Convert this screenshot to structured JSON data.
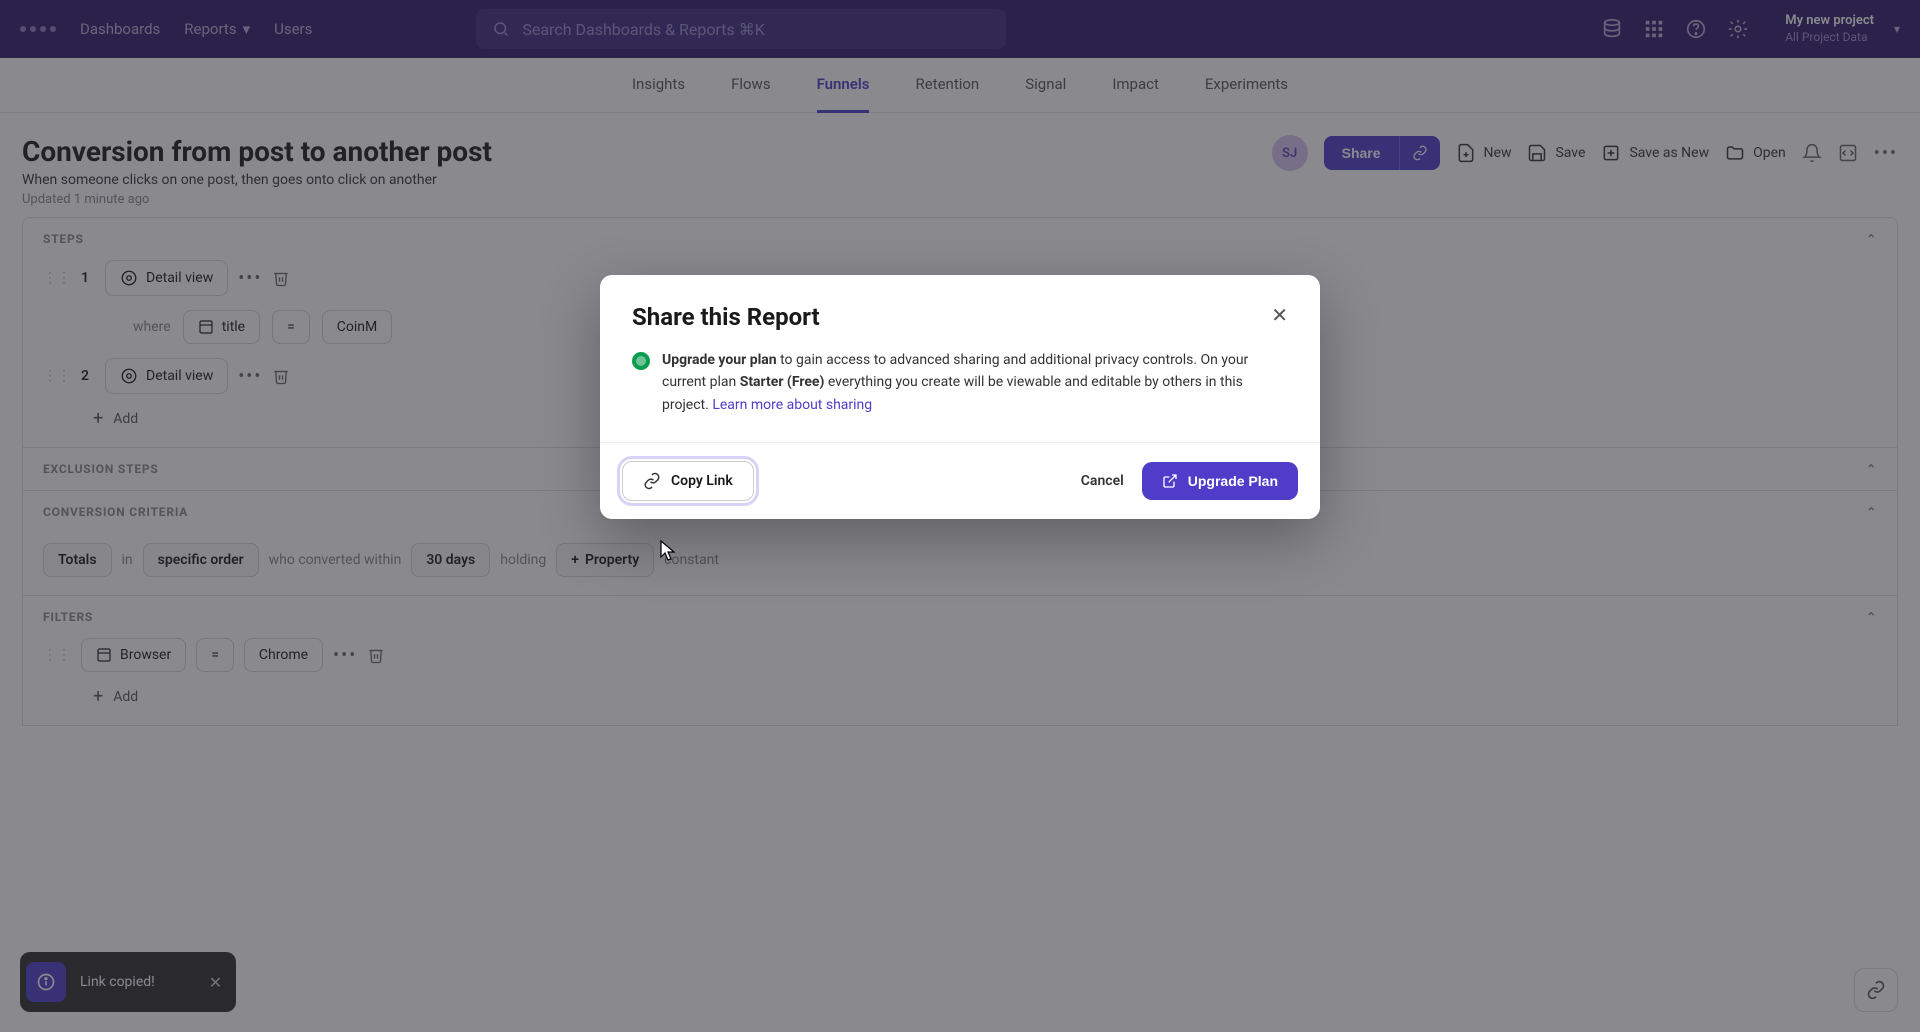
{
  "top_nav": {
    "items": [
      "Dashboards",
      "Reports",
      "Users"
    ],
    "search_placeholder": "Search Dashboards & Reports ⌘K",
    "project_name": "My new project",
    "project_scope": "All Project Data"
  },
  "sub_nav": {
    "items": [
      "Insights",
      "Flows",
      "Funnels",
      "Retention",
      "Signal",
      "Impact",
      "Experiments"
    ],
    "active": "Funnels"
  },
  "report": {
    "title": "Conversion from post to another post",
    "description": "When someone clicks on one post, then goes onto click on another",
    "updated": "Updated 1 minute ago",
    "avatar_initials": "SJ",
    "actions": {
      "share": "Share",
      "new": "New",
      "save": "Save",
      "save_as_new": "Save as New",
      "open": "Open"
    }
  },
  "steps": {
    "label": "STEPS",
    "rows": [
      {
        "num": "1",
        "label": "Detail view"
      },
      {
        "num": "2",
        "label": "Detail view"
      }
    ],
    "where": {
      "label": "where",
      "prop": "title",
      "op": "=",
      "value_prefix": "CoinM"
    },
    "add_label": "Add"
  },
  "exclusion": {
    "label": "EXCLUSION STEPS"
  },
  "criteria": {
    "label": "CONVERSION CRITERIA",
    "totals": "Totals",
    "in": "in",
    "order": "specific order",
    "who": "who converted within",
    "days": "30 days",
    "holding": "holding",
    "property": "Property",
    "constant": "constant"
  },
  "filters": {
    "label": "FILTERS",
    "prop": "Browser",
    "op": "=",
    "value": "Chrome",
    "add_label": "Add"
  },
  "toast": {
    "message": "Link copied!"
  },
  "modal": {
    "title": "Share this Report",
    "upgrade_lead": "Upgrade your plan",
    "upgrade_text1": " to gain access to advanced sharing and additional privacy controls. On your current plan ",
    "plan_name": "Starter (Free)",
    "upgrade_text2": " everything you create will be viewable and editable by others in this project. ",
    "learn_link": "Learn more about sharing",
    "copy_link": "Copy Link",
    "cancel": "Cancel",
    "upgrade_btn": "Upgrade Plan"
  }
}
